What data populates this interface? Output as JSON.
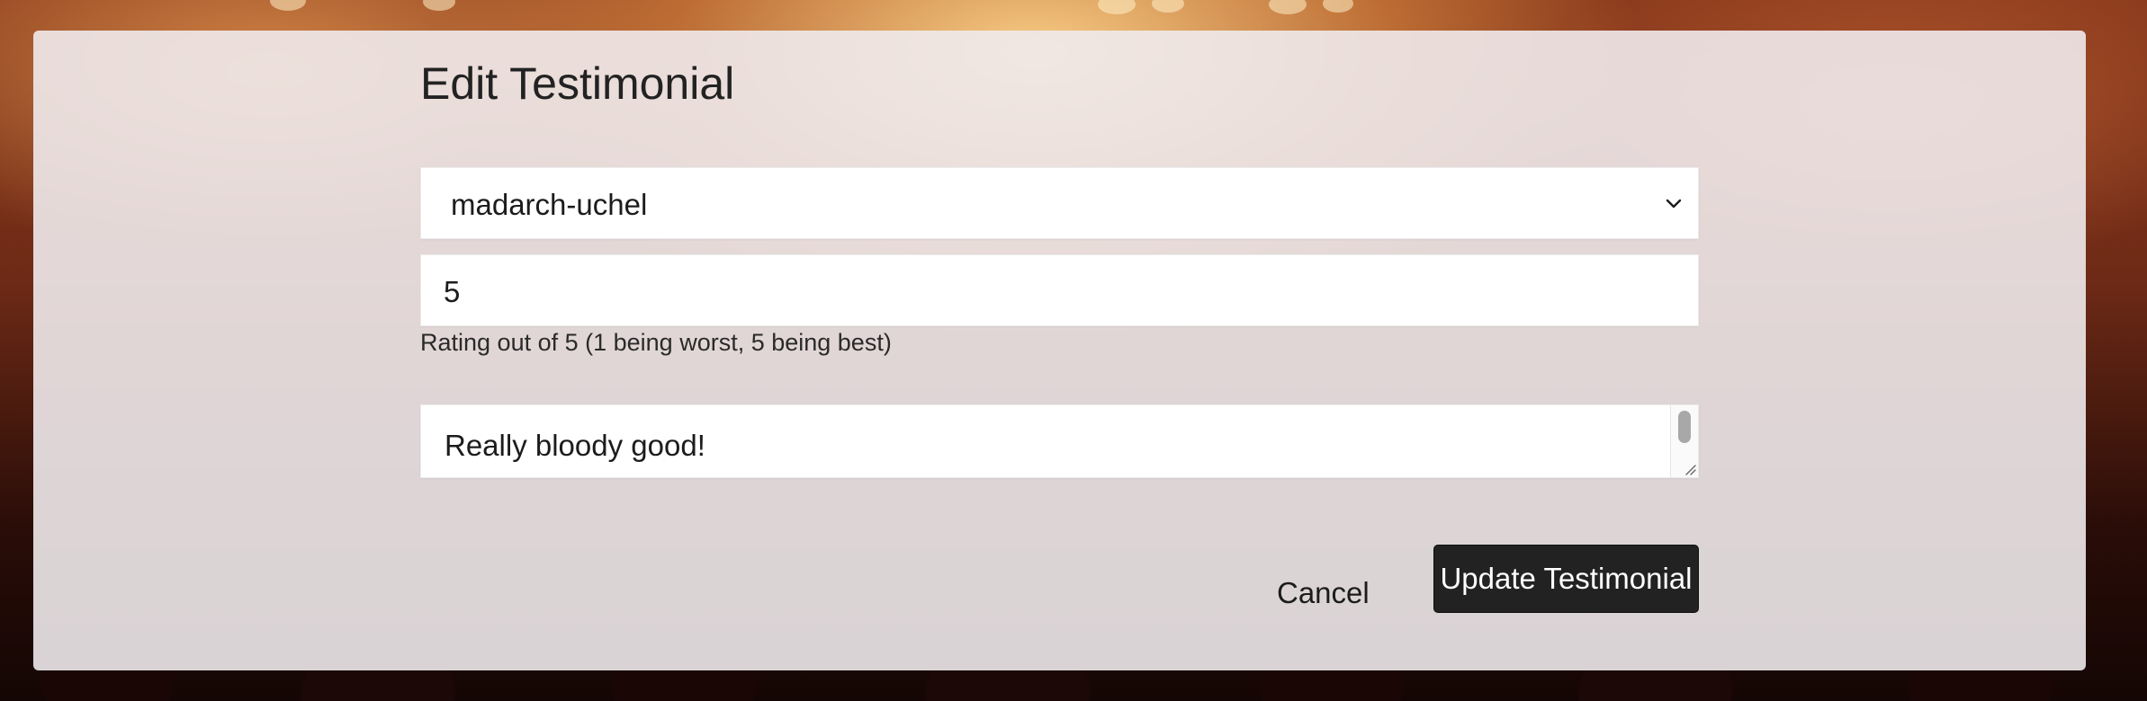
{
  "page": {
    "title": "Edit Testimonial"
  },
  "form": {
    "select": {
      "value": "madarch-uchel",
      "icon": "chevron-down-icon"
    },
    "rating": {
      "value": "5",
      "help_text": "Rating out of 5 (1 being worst, 5 being best)"
    },
    "testimonial": {
      "value": "Really bloody good!"
    }
  },
  "actions": {
    "cancel_label": "Cancel",
    "update_label": "Update Testimonial"
  },
  "colors": {
    "primary_button": "#222222",
    "card_background": "#f0eaec"
  }
}
